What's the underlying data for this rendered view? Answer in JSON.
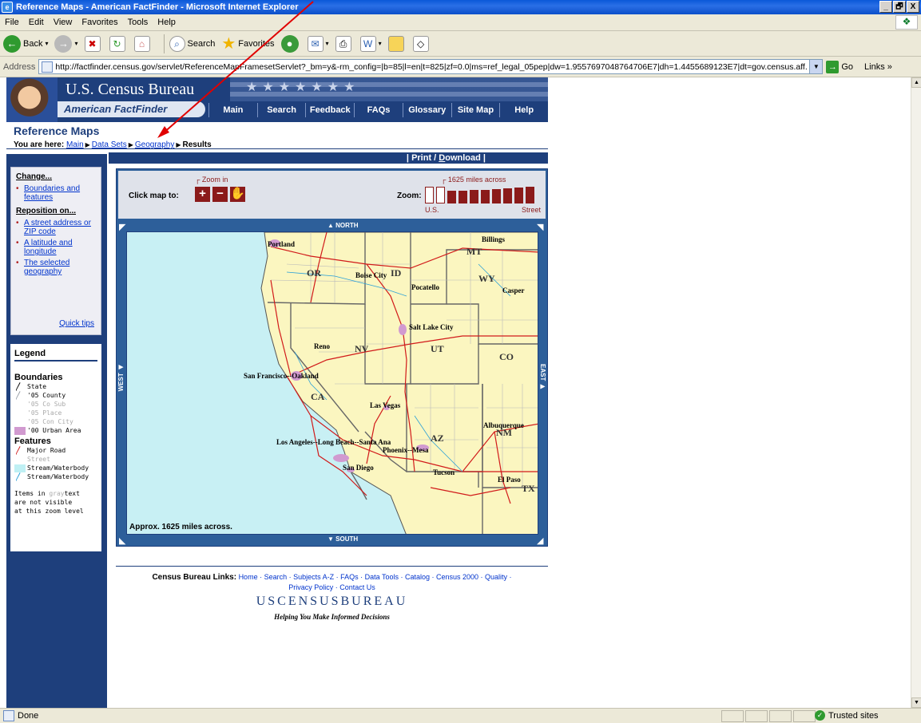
{
  "window": {
    "title": "Reference Maps - American FactFinder - Microsoft Internet Explorer",
    "buttons": [
      "_",
      "🗗",
      "X"
    ]
  },
  "menu": [
    "File",
    "Edit",
    "View",
    "Favorites",
    "Tools",
    "Help"
  ],
  "toolbar": {
    "back_label": "Back",
    "search_label": "Search",
    "favorites_label": "Favorites"
  },
  "address": {
    "label": "Address",
    "url": "http://factfinder.census.gov/servlet/ReferenceMapFramesetServlet?_bm=y&-rm_config=|b=85|l=en|t=825|zf=0.0|ms=ref_legal_05pep|dw=1.9557697048764706E7|dh=1.4455689123E7|dt=gov.census.aff.",
    "go_label": "Go",
    "links_label": "Links"
  },
  "header": {
    "bureau": "U.S. Census Bureau",
    "product": "American FactFinder",
    "nav": [
      "Main",
      "Search",
      "Feedback",
      "FAQs",
      "Glossary",
      "Site Map",
      "Help"
    ]
  },
  "page": {
    "title": "Reference Maps",
    "crumb_prefix": "You are here:",
    "crumbs": [
      "Main",
      "Data Sets",
      "Geography"
    ],
    "crumb_current": "Results",
    "print_label_a": "Print / ",
    "print_label_b": "D",
    "print_label_c": "ownload"
  },
  "change": {
    "heading": "Change...",
    "items": [
      "Boundaries and features"
    ],
    "reposition_heading": "Reposition on...",
    "reposition_items": [
      "A street address or ZIP code",
      "A latitude and longitude",
      "The selected geography"
    ],
    "quick_tips": "Quick tips"
  },
  "legend": {
    "title": "Legend",
    "boundaries_heading": "Boundaries",
    "state": "State",
    "county": "'05 County",
    "cosub": "'05 Co Sub",
    "place": "'05 Place",
    "concity": "'05 Con City",
    "urban": "'00 Urban Area",
    "features_heading": "Features",
    "major_road": "Major Road",
    "street": "Street",
    "water_area": "Stream/Waterbody",
    "water_line": "Stream/Waterbody",
    "note_a": "Items in ",
    "note_gray": "gray",
    "note_b": "text",
    "note_c": "are not visible",
    "note_d": "at this zoom level",
    "colors": {
      "state": "#333333",
      "county": "#9aa0a8",
      "urban": "#d19ad0",
      "road": "#d11a1a",
      "water": "#bff0f4",
      "water_line": "#2aa0d8"
    }
  },
  "map": {
    "zoom_in_label": "Zoom in",
    "click_label": "Click map to:",
    "miles_label": "1625 miles across",
    "zoom_label": "Zoom:",
    "us_label": "U.S.",
    "street_label": "Street",
    "north": "NORTH",
    "south": "SOUTH",
    "east": "EAST",
    "west": "WEST",
    "approx": "Approx. 1625 miles across.",
    "states": [
      "OR",
      "ID",
      "MT",
      "WY",
      "NV",
      "UT",
      "CO",
      "CA",
      "AZ",
      "NM",
      "TX"
    ],
    "cities": [
      "Portland",
      "Billings",
      "Boise City",
      "Pocatello",
      "Casper",
      "Salt Lake City",
      "Reno",
      "San Francisco--Oakland",
      "Las Vegas",
      "Albuquerque",
      "Los Angeles--Long Beach--Santa Ana",
      "Phoenix--Mesa",
      "San Diego",
      "Tucson",
      "El Paso"
    ]
  },
  "footer": {
    "links_label": "Census Bureau Links:",
    "links_line1": "Home · Search · Subjects A-Z · FAQs · Data Tools · Catalog · Census 2000 · Quality ·",
    "links_line2": "Privacy Policy · Contact Us",
    "logo": "USCENSUSBUREAU",
    "tagline": "Helping You Make Informed Decisions"
  },
  "status": {
    "text": "Done",
    "zone": "Trusted sites"
  }
}
